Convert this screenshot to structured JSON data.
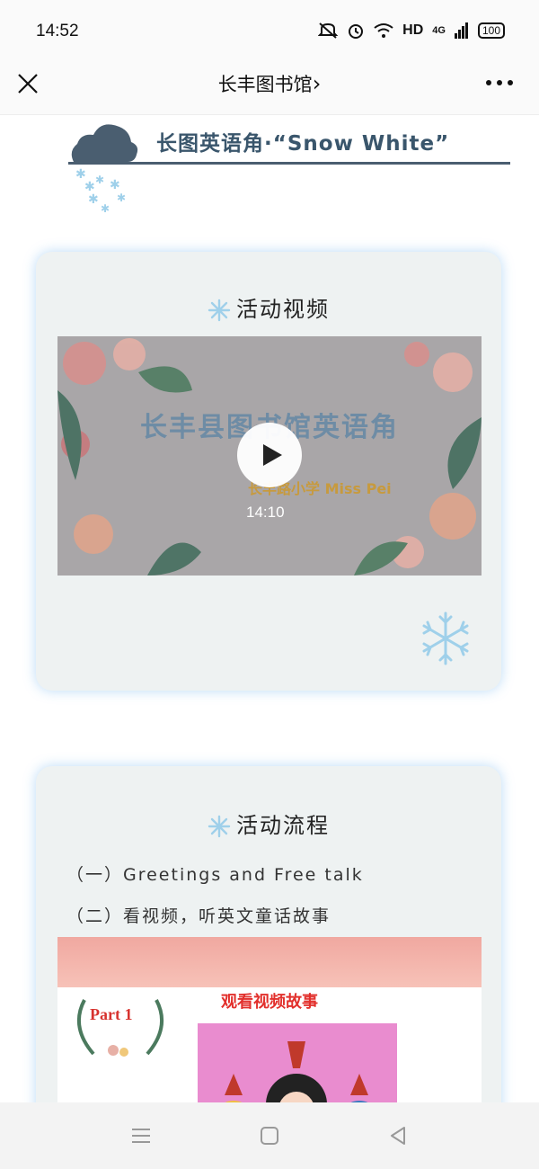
{
  "status_bar": {
    "time": "14:52",
    "network": "HD",
    "signal": "4G",
    "battery": "100"
  },
  "nav": {
    "title": "长丰图书馆",
    "chevron": "›"
  },
  "header": {
    "title": "长图英语角·“Snow White”",
    "line_color": "#4a5e70"
  },
  "video_card": {
    "heading": "活动视频",
    "video": {
      "title": "长丰县图书馆英语角",
      "subtitle": "长丰路小学 Miss Pei",
      "duration": "14:10"
    }
  },
  "flow_card": {
    "heading": "活动流程",
    "items": [
      "（一）Greetings and Free talk",
      "（二）看视频，听英文童话故事"
    ],
    "slide": {
      "title": "观看视频故事",
      "part": "Part 1"
    }
  },
  "colors": {
    "accent": "#3a566c",
    "card_bg": "#eef2f2",
    "snowflake": "#9fd0ea"
  }
}
